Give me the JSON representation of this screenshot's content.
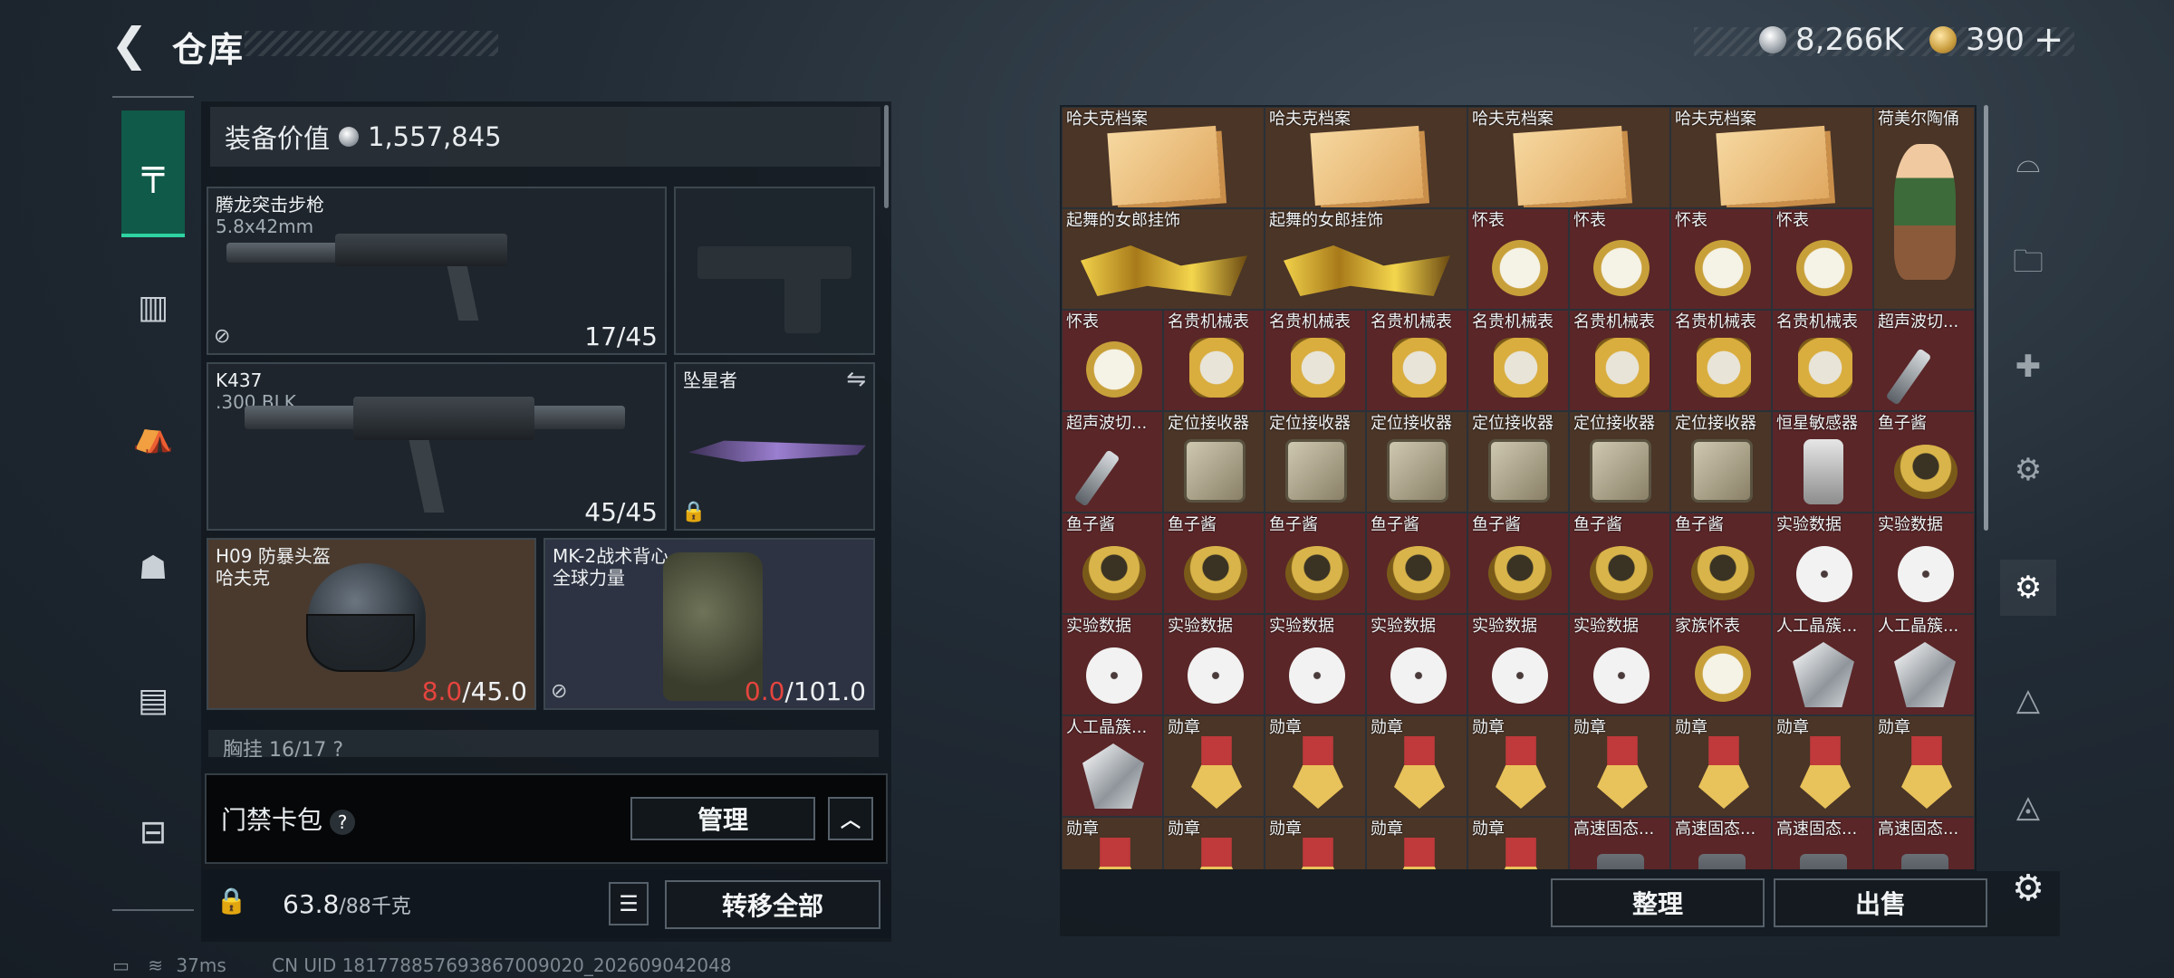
{
  "header": {
    "title": "仓库",
    "silver": "8,266K",
    "gold": "390",
    "plus": "+"
  },
  "nav": {
    "icons": [
      "pistol-icon",
      "vest-icon",
      "backpack-icon",
      "bag-icon",
      "clipboard-icon",
      "toolbox-icon"
    ]
  },
  "loadout": {
    "value_label": "装备价值",
    "value": "1,557,845",
    "primary": {
      "name": "腾龙突击步枪",
      "caliber": "5.8x42mm",
      "ammo": "17/45"
    },
    "secondary": {
      "name": "K437",
      "caliber": ".300 BLK",
      "ammo": "45/45"
    },
    "melee": {
      "name": "坠星者"
    },
    "helmet": {
      "name": "H09 防暴头盔",
      "brand": "哈夫克",
      "dur_cur": "8.0",
      "dur_max": "/45.0"
    },
    "armor": {
      "name": "MK-2战术背心",
      "brand": "全球力量",
      "dur_cur": "0.0",
      "dur_max": "/101.0"
    },
    "chest": "胸挂  16/17  ?",
    "keycard": {
      "label": "门禁卡包",
      "q": "?",
      "manage": "管理"
    },
    "weight": "63.8",
    "weight_max": "/88千克",
    "transfer": "转移全部"
  },
  "status": {
    "ping": "37ms",
    "uid": "CN UID 181778857693867009020_202609042048"
  },
  "storage": {
    "sort": "整理",
    "sell": "出售",
    "rows": [
      [
        "哈夫克档案",
        "哈夫克档案",
        "哈夫克档案",
        "哈夫克档案",
        "荷美尔陶俑"
      ],
      [
        "起舞的女郎挂饰",
        "起舞的女郎挂饰",
        "怀表",
        "怀表",
        "怀表",
        "怀表"
      ],
      [
        "怀表",
        "名贵机械表",
        "名贵机械表",
        "名贵机械表",
        "名贵机械表",
        "名贵机械表",
        "名贵机械表",
        "名贵机械表",
        "超声波切..."
      ],
      [
        "超声波切...",
        "定位接收器",
        "定位接收器",
        "定位接收器",
        "定位接收器",
        "定位接收器",
        "定位接收器",
        "恒星敏感器",
        "鱼子酱"
      ],
      [
        "鱼子酱",
        "鱼子酱",
        "鱼子酱",
        "鱼子酱",
        "鱼子酱",
        "鱼子酱",
        "鱼子酱",
        "实验数据",
        "实验数据"
      ],
      [
        "实验数据",
        "实验数据",
        "实验数据",
        "实验数据",
        "实验数据",
        "实验数据",
        "家族怀表",
        "人工晶簇...",
        "人工晶簇..."
      ],
      [
        "人工晶簇...",
        "勋章",
        "勋章",
        "勋章",
        "勋章",
        "勋章",
        "勋章",
        "勋章",
        "勋章"
      ],
      [
        "勋章",
        "勋章",
        "勋章",
        "勋章",
        "勋章",
        "高速固态...",
        "高速固态...",
        "高速固态...",
        "高速固态..."
      ]
    ]
  },
  "colors": {
    "accent": "#2fd3a2",
    "cell_red": "#5a2628",
    "durability_red": "#e5443e"
  }
}
